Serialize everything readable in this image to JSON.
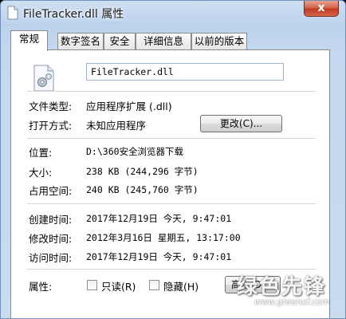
{
  "window": {
    "title": "FileTracker.dll 属性",
    "close_label": "x"
  },
  "tabs": [
    {
      "label": "常规"
    },
    {
      "label": "数字签名"
    },
    {
      "label": "安全"
    },
    {
      "label": "详细信息"
    },
    {
      "label": "以前的版本"
    }
  ],
  "general": {
    "file_name": "FileTracker.dll",
    "file_type_label": "文件类型:",
    "file_type_value": "应用程序扩展 (.dll)",
    "open_with_label": "打开方式:",
    "open_with_value": "未知应用程序",
    "change_button": "更改(C)...",
    "location_label": "位置:",
    "location_value": "D:\\360安全浏览器下载",
    "size_label": "大小:",
    "size_value": "238 KB (244,296 字节)",
    "size_on_disk_label": "占用空间:",
    "size_on_disk_value": "240 KB (245,760 字节)",
    "created_label": "创建时间:",
    "created_value": "2017年12月19日 今天, 9:47:01",
    "modified_label": "修改时间:",
    "modified_value": "2012年3月16日 星期五, 13:17:00",
    "accessed_label": "访问时间:",
    "accessed_value": "2017年12月19日 今天, 9:47:01",
    "attributes_label": "属性:",
    "readonly_label": "只读(R)",
    "hidden_label": "隐藏(H)",
    "advanced_button": "高级(D)..."
  },
  "watermark": {
    "text": "绿色先锋",
    "url": "www.greenxf.com"
  }
}
